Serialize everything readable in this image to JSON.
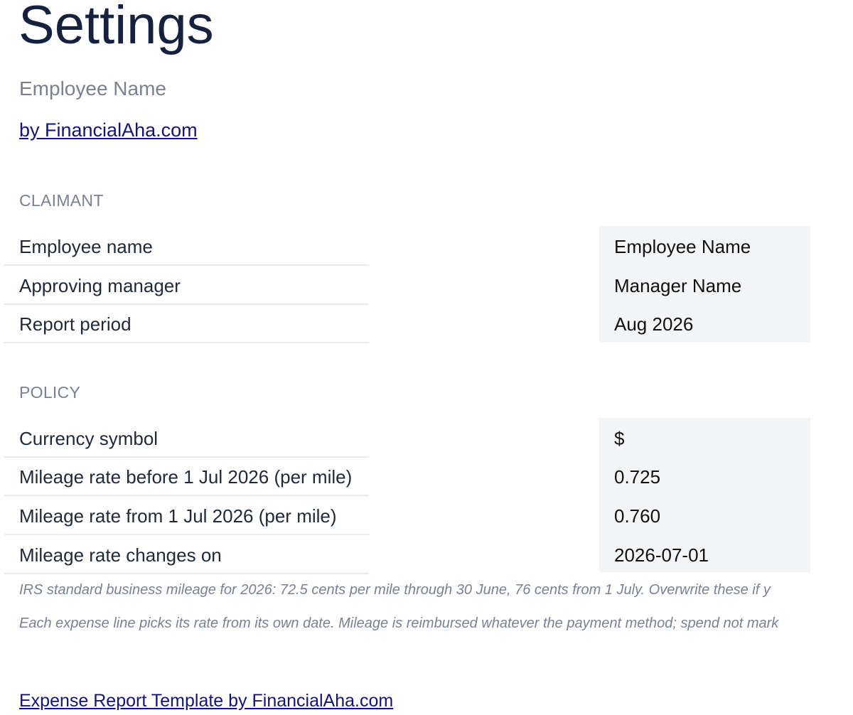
{
  "header": {
    "title": "Settings",
    "subtitle": "Employee Name",
    "brand_link": "by FinancialAha.com"
  },
  "claimant": {
    "heading": "CLAIMANT",
    "rows": [
      {
        "label": "Employee name",
        "value": "Employee Name"
      },
      {
        "label": "Approving manager",
        "value": "Manager Name"
      },
      {
        "label": "Report period",
        "value": "Aug 2026"
      }
    ]
  },
  "policy": {
    "heading": "POLICY",
    "rows": [
      {
        "label": "Currency symbol",
        "value": "$"
      },
      {
        "label": "Mileage rate before 1 Jul 2026 (per mile)",
        "value": "0.725"
      },
      {
        "label": "Mileage rate from 1 Jul 2026 (per mile)",
        "value": "0.760"
      },
      {
        "label": "Mileage rate changes on",
        "value": "2026-07-01"
      }
    ],
    "notes": [
      "IRS standard business mileage for 2026: 72.5 cents per mile through 30 June, 76 cents from 1 July. Overwrite these if y",
      "Each expense line picks its rate from its own date. Mileage is reimbursed whatever the payment method; spend not mark"
    ]
  },
  "footer": {
    "link": "Expense Report Template by FinancialAha.com"
  },
  "colors": {
    "title": "#16213e",
    "muted": "#7b8190",
    "link": "#14147a",
    "value_panel": "#f3f4f6",
    "rule": "#e8eaed"
  }
}
